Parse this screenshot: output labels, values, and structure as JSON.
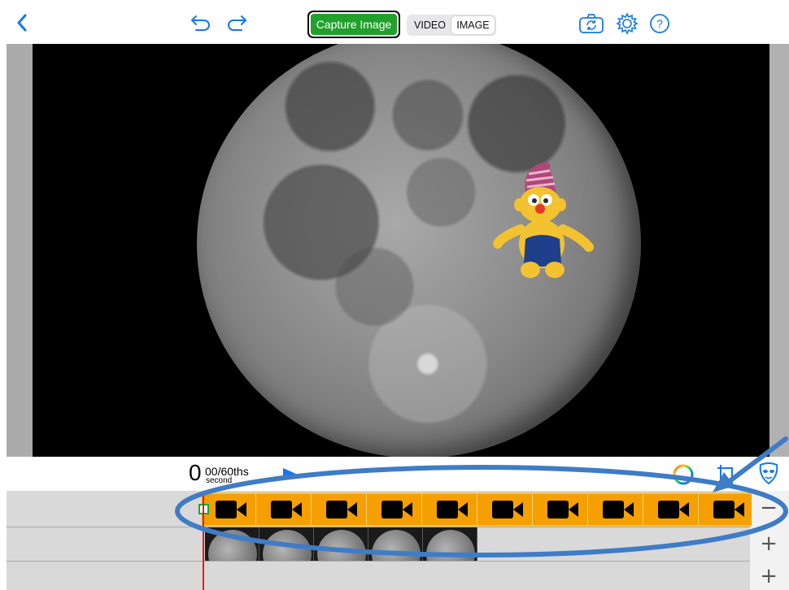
{
  "toolbar": {
    "back_icon": "chevron-left-icon",
    "undo_icon": "undo-icon",
    "redo_icon": "redo-icon",
    "capture_label": "Capture Image",
    "mode_video_label": "VIDEO",
    "mode_image_label": "IMAGE",
    "active_mode": "IMAGE",
    "camera_switch_icon": "camera-switch-icon",
    "settings_icon": "gear-icon",
    "help_icon": "help-icon",
    "accent_color": "#1478f0",
    "capture_color": "#21a02b"
  },
  "stage": {
    "background_icon": "moon-image",
    "sticker_icon": "plush-gnome-sticker"
  },
  "timebar": {
    "seconds": "0",
    "fraction": "00/60ths",
    "unit": "second",
    "play_icon": "play-icon",
    "color_wheel_icon": "color-wheel-icon",
    "crop_icon": "crop-icon",
    "mask_icon": "mask-icon"
  },
  "timeline": {
    "video_track_color": "#f5a000",
    "segments": [
      "video-camera-icon",
      "video-camera-icon",
      "video-camera-icon",
      "video-camera-icon",
      "video-camera-icon",
      "video-camera-icon",
      "video-camera-icon",
      "video-camera-icon",
      "video-camera-icon",
      "video-camera-icon"
    ],
    "thumbnails": [
      "moon-thumbnail",
      "moon-thumbnail",
      "moon-thumbnail",
      "moon-thumbnail",
      "moon-thumbnail"
    ],
    "minus_label": "−",
    "plus_label_1": "+",
    "plus_label_2": "+",
    "playhead_color": "#e61b1b"
  },
  "annotation": {
    "ellipse_color": "#3f7cc6"
  }
}
